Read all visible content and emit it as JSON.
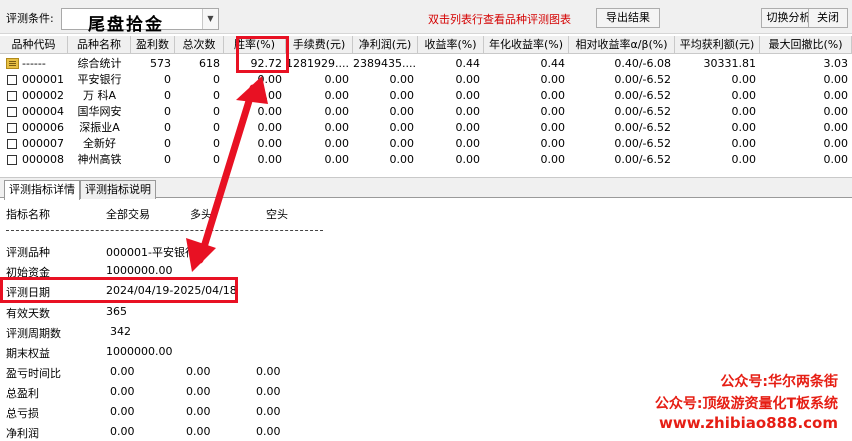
{
  "toolbar": {
    "label": "评测条件:",
    "condition": "尾盘拾金",
    "hint": "双击列表行查看品种评测图表",
    "export": "导出结果",
    "switch": "切换分析图",
    "close": "关闭"
  },
  "table": {
    "headers": [
      "品种代码",
      "品种名称",
      "盈利数",
      "总次数",
      "胜率(%)",
      "手续费(元)",
      "净利润(元)",
      "收益率(%)",
      "年化收益率(%)",
      "相对收益率α/β(%)",
      "平均获利额(元)",
      "最大回撤比(%)"
    ],
    "summary": {
      "cells": [
        "------",
        "综合统计",
        "573",
        "618",
        "92.72",
        "1281929....",
        "2389435....",
        "0.44",
        "0.44",
        "0.40/-6.08",
        "30331.81",
        "3.03"
      ]
    },
    "rows": [
      [
        "000001",
        "平安银行",
        "0",
        "0",
        "0.00",
        "0.00",
        "0.00",
        "0.00",
        "0.00",
        "0.00/-6.52",
        "0.00",
        "0.00"
      ],
      [
        "000002",
        "万 科A",
        "0",
        "0",
        "0.00",
        "0.00",
        "0.00",
        "0.00",
        "0.00",
        "0.00/-6.52",
        "0.00",
        "0.00"
      ],
      [
        "000004",
        "国华网安",
        "0",
        "0",
        "0.00",
        "0.00",
        "0.00",
        "0.00",
        "0.00",
        "0.00/-6.52",
        "0.00",
        "0.00"
      ],
      [
        "000006",
        "深振业A",
        "0",
        "0",
        "0.00",
        "0.00",
        "0.00",
        "0.00",
        "0.00",
        "0.00/-6.52",
        "0.00",
        "0.00"
      ],
      [
        "000007",
        "全新好",
        "0",
        "0",
        "0.00",
        "0.00",
        "0.00",
        "0.00",
        "0.00",
        "0.00/-6.52",
        "0.00",
        "0.00"
      ],
      [
        "000008",
        "神州高铁",
        "0",
        "0",
        "0.00",
        "0.00",
        "0.00",
        "0.00",
        "0.00",
        "0.00/-6.52",
        "0.00",
        "0.00"
      ]
    ]
  },
  "tabs": [
    "评测指标详情",
    "评测指标说明"
  ],
  "details": {
    "col_headers": [
      "指标名称",
      "全部交易",
      "多头",
      "空头"
    ],
    "stock": {
      "label": "评测品种",
      "value": "000001-平安银行"
    },
    "capital": {
      "label": "初始资金",
      "value": "1000000.00"
    },
    "date": {
      "label": "评测日期",
      "value": "2024/04/19-2025/04/18"
    },
    "valid_days": {
      "label": "有效天数",
      "value": "365"
    },
    "period": {
      "label": "评测周期数",
      "value": "342"
    },
    "end_equity": {
      "label": "期末权益",
      "value": "1000000.00"
    },
    "pl_time": {
      "label": "盈亏时间比",
      "values": [
        "0.00",
        "0.00",
        "0.00"
      ]
    },
    "total_profit": {
      "label": "总盈利",
      "values": [
        "0.00",
        "0.00",
        "0.00"
      ]
    },
    "total_loss": {
      "label": "总亏损",
      "values": [
        "0.00",
        "0.00",
        "0.00"
      ]
    },
    "net_profit": {
      "label": "净利润",
      "values": [
        "0.00",
        "0.00",
        "0.00"
      ]
    }
  },
  "watermark": {
    "line1": "公众号:华尔两条街",
    "line2": "公众号:顶级游资量化T板系统",
    "line3": "www.zhibiao888.com"
  },
  "colors": {
    "accent_red": "#e81123",
    "hint_red": "#d40000",
    "watermark_red": "#e61e14"
  }
}
